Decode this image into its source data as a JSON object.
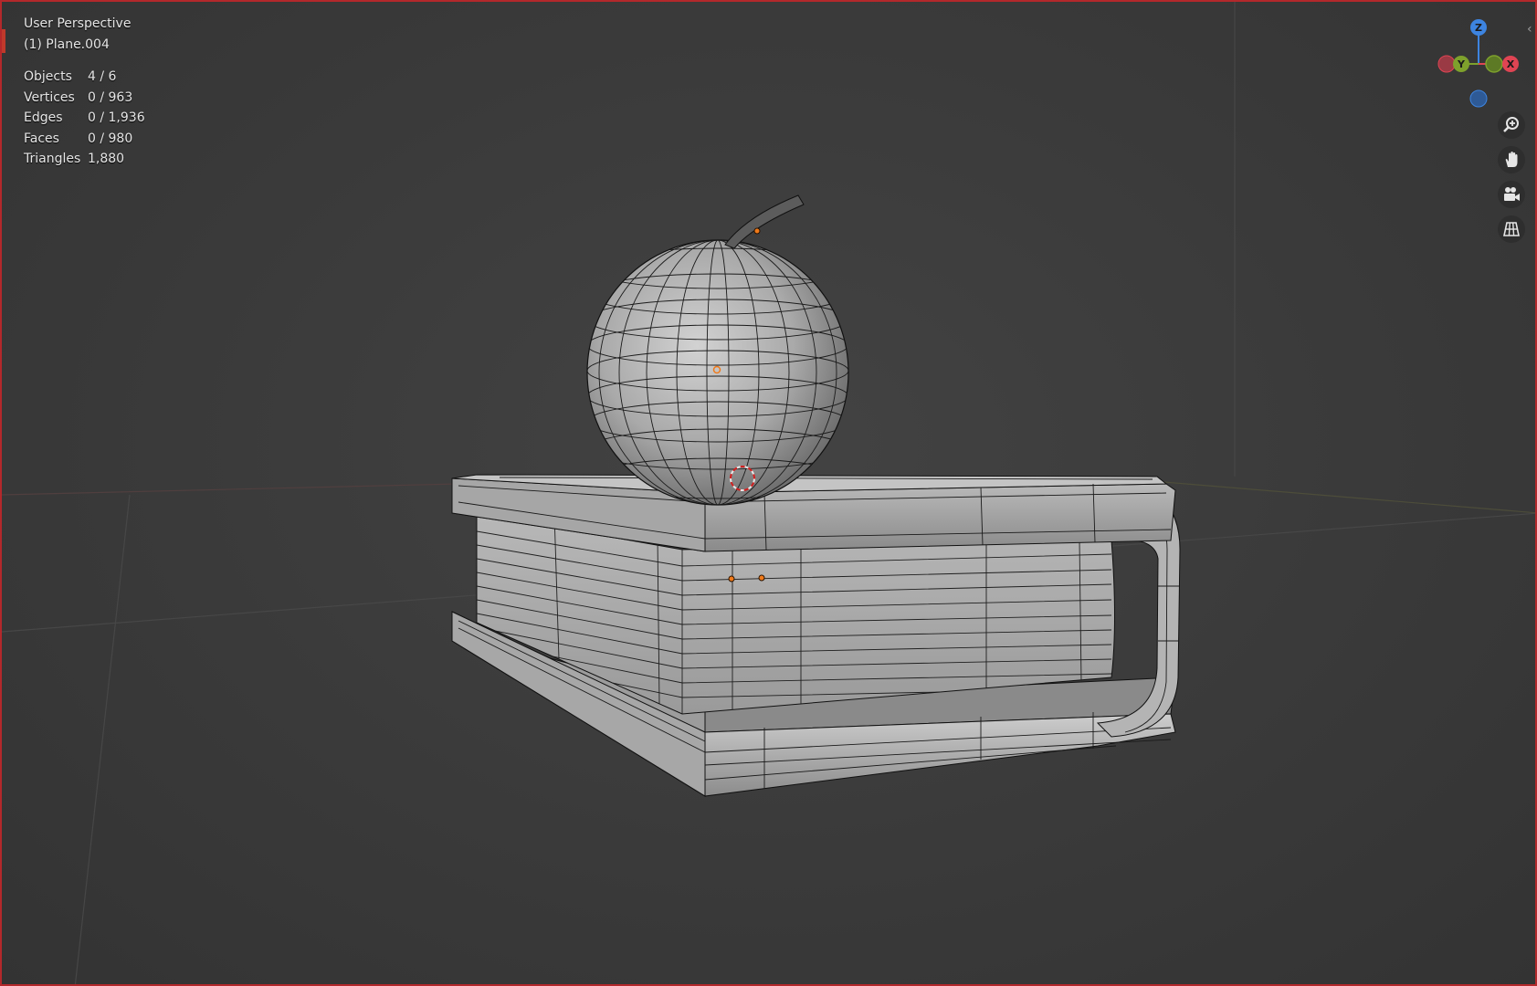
{
  "viewport": {
    "view_name": "User Perspective",
    "active_object": "(1) Plane.004"
  },
  "stats": [
    {
      "label": "Objects",
      "value": "4 / 6"
    },
    {
      "label": "Vertices",
      "value": "0 / 963"
    },
    {
      "label": "Edges",
      "value": "0 / 1,936"
    },
    {
      "label": "Faces",
      "value": "0 / 980"
    },
    {
      "label": "Triangles",
      "value": "1,880"
    }
  ],
  "gizmo": {
    "z_label": "Z",
    "y_label": "Y",
    "x_label": "X",
    "colors": {
      "x": "#e04453",
      "y": "#7ea12c",
      "z": "#3d84e0"
    }
  },
  "nav_buttons": [
    {
      "name": "zoom-icon",
      "title": "Zoom"
    },
    {
      "name": "hand-icon",
      "title": "Pan"
    },
    {
      "name": "camera-icon",
      "title": "Camera view"
    },
    {
      "name": "grid-icon",
      "title": "Toggle perspective"
    }
  ],
  "colors": {
    "background": "#3b3b3b",
    "border": "#b3282b",
    "wire": "#1a1a1a",
    "mesh_light": "#c9c9c9",
    "mesh_dark": "#7d7d7d",
    "origin": "#f07a1a"
  }
}
